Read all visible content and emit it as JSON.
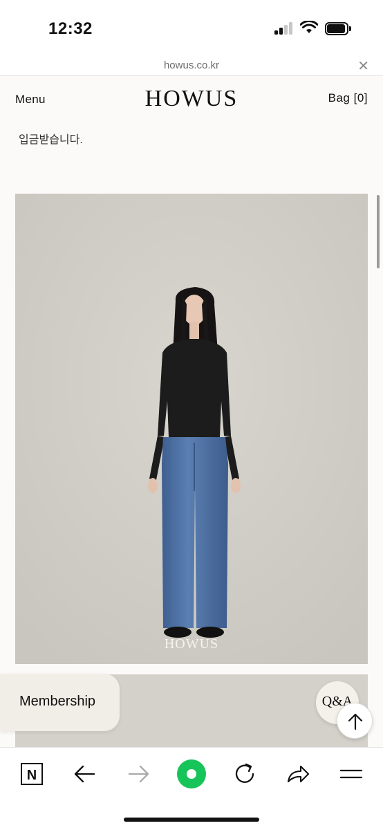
{
  "status": {
    "time": "12:32"
  },
  "browser": {
    "url": "howus.co.kr",
    "close_glyph": "✕"
  },
  "header": {
    "menu_label": "Menu",
    "logo": "HOWUS",
    "bag_label": "Bag [0]"
  },
  "content": {
    "cut_text": "· · · · · · · · · · · · · · · · ·",
    "body_text": "입금받습니다.",
    "image_watermark": "HOWUS",
    "image_alt": "Model wearing black knit sweater and blue wide denim jeans"
  },
  "floating": {
    "membership_label": "Membership",
    "qa_label": "Q&A"
  },
  "toolbar": {
    "icons": [
      "naver-n-icon",
      "back-arrow-icon",
      "forward-arrow-icon",
      "green-dot-icon",
      "reload-icon",
      "share-icon",
      "hamburger-menu-icon"
    ],
    "n_letter": "N"
  },
  "colors": {
    "accent_green": "#16c45a",
    "background": "#fbfaf8",
    "photo_backdrop": "#d1cec8"
  }
}
